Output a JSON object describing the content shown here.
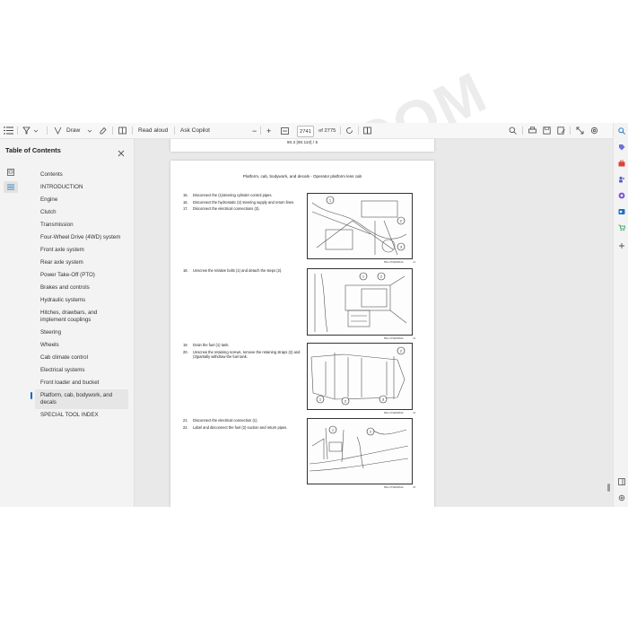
{
  "toolbar": {
    "draw_label": "Draw",
    "read_aloud_label": "Read aloud",
    "ask_copilot_label": "Ask Copilot",
    "page_current": "2741",
    "page_total": "of 2775"
  },
  "toc": {
    "title": "Table of Contents",
    "items": [
      {
        "label": "Contents"
      },
      {
        "label": "INTRODUCTION"
      },
      {
        "label": "Engine"
      },
      {
        "label": "Clutch"
      },
      {
        "label": "Transmission"
      },
      {
        "label": "Four-Wheel Drive (4WD) system"
      },
      {
        "label": "Front axle system"
      },
      {
        "label": "Rear axle system"
      },
      {
        "label": "Power Take-Off (PTO)"
      },
      {
        "label": "Brakes and controls"
      },
      {
        "label": "Hydraulic systems"
      },
      {
        "label": "Hitches, drawbars, and implement couplings"
      },
      {
        "label": "Steering"
      },
      {
        "label": "Wheels"
      },
      {
        "label": "Cab climate control"
      },
      {
        "label": "Electrical systems"
      },
      {
        "label": "Front loader and bucket"
      },
      {
        "label": "Platform, cab, bodywork, and decals"
      },
      {
        "label": "SPECIAL TOOL INDEX"
      }
    ],
    "active_index": 17
  },
  "document": {
    "prev_page_footer": "90.3 [90.110] / 5",
    "page_header": "Platform, cab, bodywork, and decals - Operator platform less cab",
    "groups": [
      {
        "steps": [
          {
            "num": "15.",
            "text": "Disconnect the (1)steering cylinder control pipes."
          },
          {
            "num": "16.",
            "text": "Disconnect the hydrostatic (2) steering supply and return lines."
          },
          {
            "num": "17.",
            "text": "Disconnect the electrical connections (3)."
          }
        ],
        "figure_code": "BSLL17SE00061A",
        "figure_number": "12"
      },
      {
        "steps": [
          {
            "num": "18.",
            "text": "Unscrew the relative bolts (1) and detach the steps (2)."
          }
        ],
        "figure_code": "BSLL17SE00062A",
        "figure_number": "13"
      },
      {
        "steps": [
          {
            "num": "19.",
            "text": "Drain the fuel (1) tank."
          },
          {
            "num": "20.",
            "text": "Unscrew the retaining screws, remove the retaining straps (2) and (3)partially withdraw the fuel tank."
          }
        ],
        "figure_code": "BSLL17SE00063A",
        "figure_number": "14"
      },
      {
        "steps": [
          {
            "num": "21.",
            "text": "Disconnect the electrical connection (1)."
          },
          {
            "num": "22.",
            "text": "Label and disconnect the fuel (2) suction and return pipes."
          }
        ],
        "figure_code": "BSLL17SE00064A",
        "figure_number": "15"
      }
    ]
  },
  "watermark": "EPCDEPOT.COM",
  "colors": {
    "accent": "#0f6cbd",
    "toolbar_bg": "#f7f7f7",
    "viewer_bg": "#e9e9e9"
  }
}
